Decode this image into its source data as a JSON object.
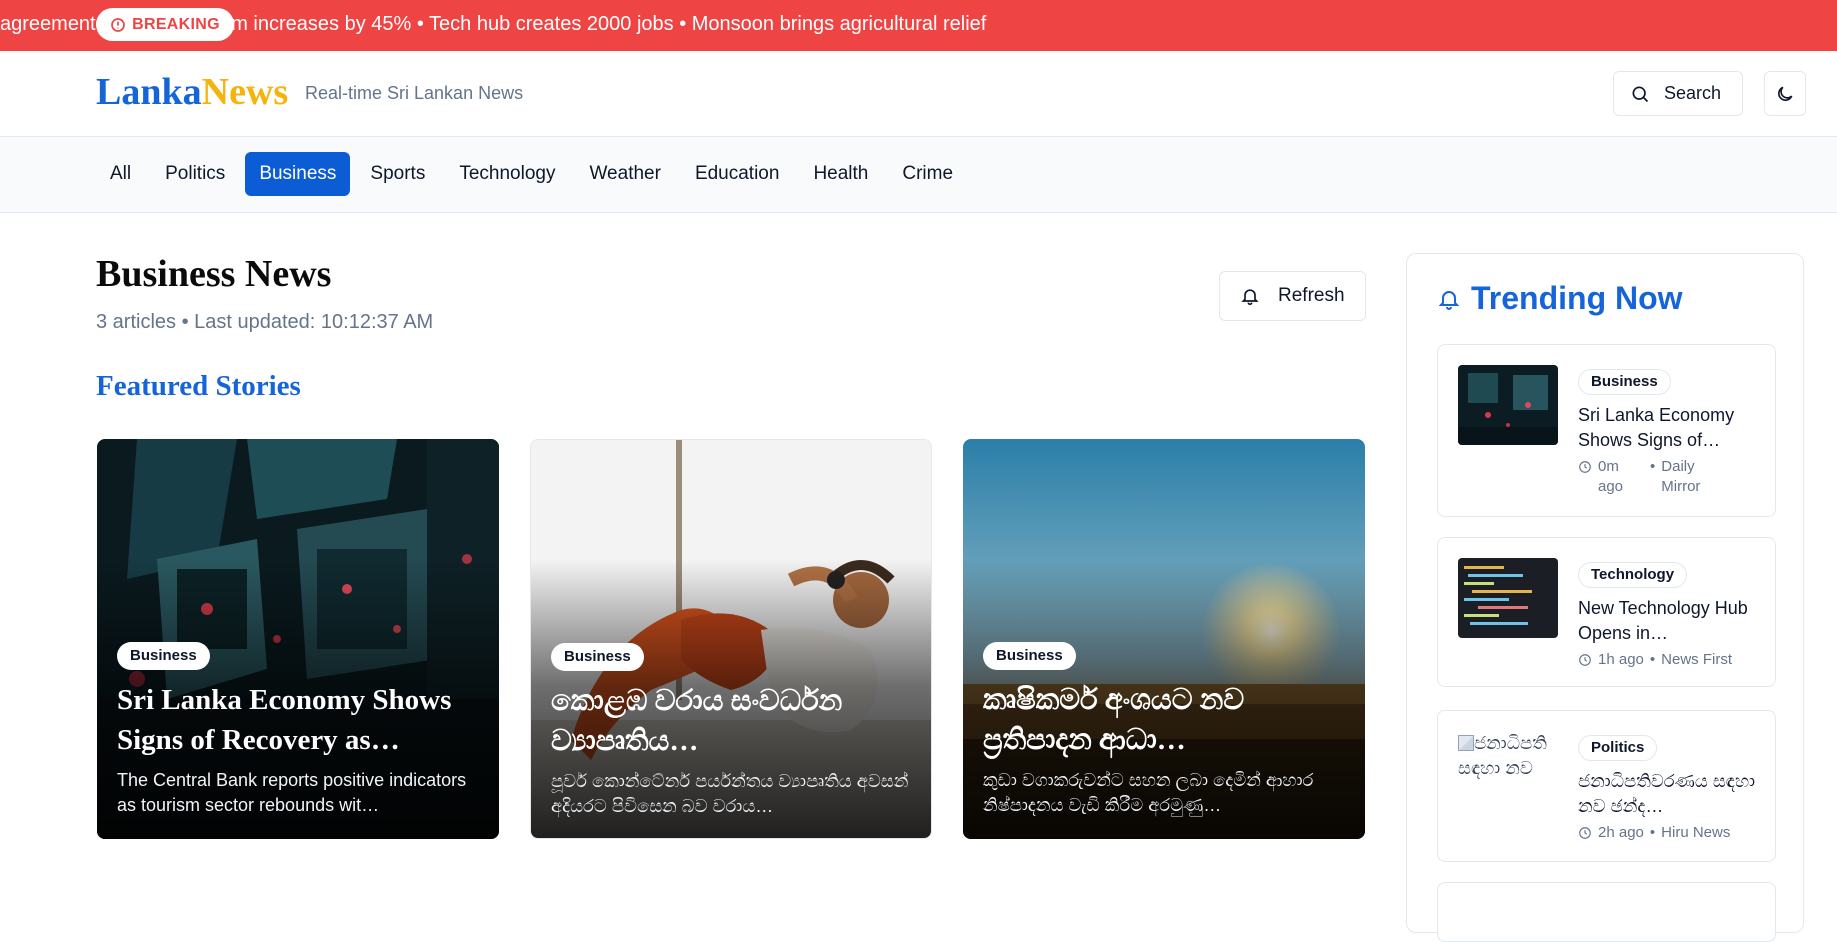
{
  "ticker": {
    "text": "agreement signed  • Tourism increases by 45% • Tech hub creates 2000 jobs • Monsoon brings agricultural relief",
    "breaking_label": "BREAKING"
  },
  "header": {
    "logo_part1": "Lanka",
    "logo_part2": "News",
    "tagline": "Real-time Sri Lankan News",
    "search_label": "Search",
    "theme_icon": "moon-icon"
  },
  "categories": [
    "All",
    "Politics",
    "Business",
    "Sports",
    "Technology",
    "Weather",
    "Education",
    "Health",
    "Crime"
  ],
  "active_category": "Business",
  "main": {
    "title": "Business News",
    "meta": "3 articles • Last updated: 10:12:37 AM",
    "refresh_label": "Refresh",
    "featured_title": "Featured Stories"
  },
  "featured": [
    {
      "badge": "Business",
      "title": "Sri Lanka Economy Shows Signs of Recovery as…",
      "desc": "The Central Bank reports positive indicators as tourism sector rebounds wit…"
    },
    {
      "badge": "Business",
      "title": "කොළඹ වරාය සංවර්ධන ව්‍යාපෘතිය…",
      "desc": "පූර්ව කොන්ටේනර් පර්යන්තය ව්‍යාපෘතිය අවසන් අදියරට පිවිසෙන බව වරාය…"
    },
    {
      "badge": "Business",
      "title": "කෘෂිකර්ම අංශයට නව ප්‍රතිපාදන ආධා…",
      "desc": "කුඩා වගාකරුවන්ට සහන ලබා දෙමින් ආහාර නිෂ්පාදනය වැඩි කිරීම අරමුණු…"
    }
  ],
  "trending": {
    "title": "Trending Now",
    "items": [
      {
        "badge": "Business",
        "title": "Sri Lanka Economy Shows Signs of…",
        "time": "0m ago",
        "source": "Daily Mirror"
      },
      {
        "badge": "Technology",
        "title": "New Technology Hub Opens in…",
        "time": "1h ago",
        "source": "News First"
      },
      {
        "badge": "Politics",
        "title": "ජනාධිපතිවරණය සඳහා නව ඡන්ද…",
        "time": "2h ago",
        "source": "Hiru News",
        "img_alt": "ජනාධිපති සඳහා නව"
      }
    ]
  },
  "colors": {
    "ticker_bg": "#ef4444",
    "brand_blue": "#1565d8",
    "brand_yellow": "#f5b30b",
    "active_tab": "#0b5cd5"
  }
}
